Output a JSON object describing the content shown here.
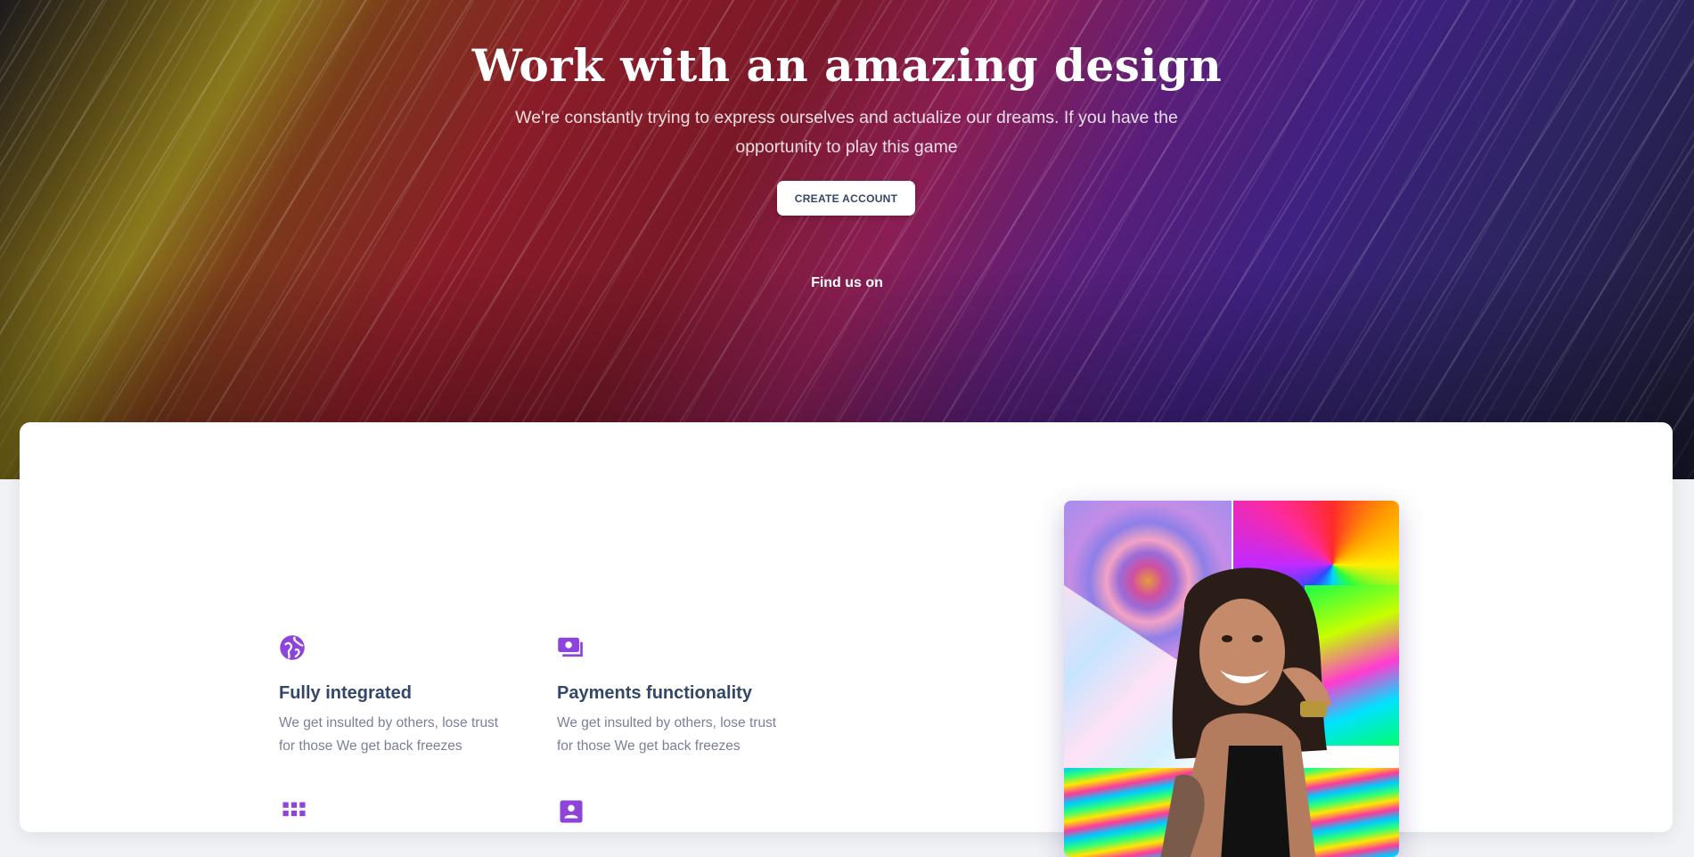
{
  "hero": {
    "title": "Work with an amazing design",
    "subtitle": "We're constantly trying to express ourselves and actualize our dreams. If you have the opportunity to play this game",
    "cta_label": "CREATE ACCOUNT",
    "find_us": "Find us on"
  },
  "features": [
    {
      "icon": "globe-icon",
      "title": "Fully integrated",
      "description": "We get insulted by others, lose trust for those We get back freezes"
    },
    {
      "icon": "payments-icon",
      "title": "Payments functionality",
      "description": "We get insulted by others, lose trust for those We get back freezes"
    },
    {
      "icon": "apps-grid-icon",
      "title": "",
      "description": ""
    },
    {
      "icon": "contact-card-icon",
      "title": "",
      "description": ""
    }
  ],
  "colors": {
    "accent": "#8e44d8",
    "heading": "#344767",
    "body_text": "#7b809a",
    "page_bg": "#f0f2f5"
  }
}
